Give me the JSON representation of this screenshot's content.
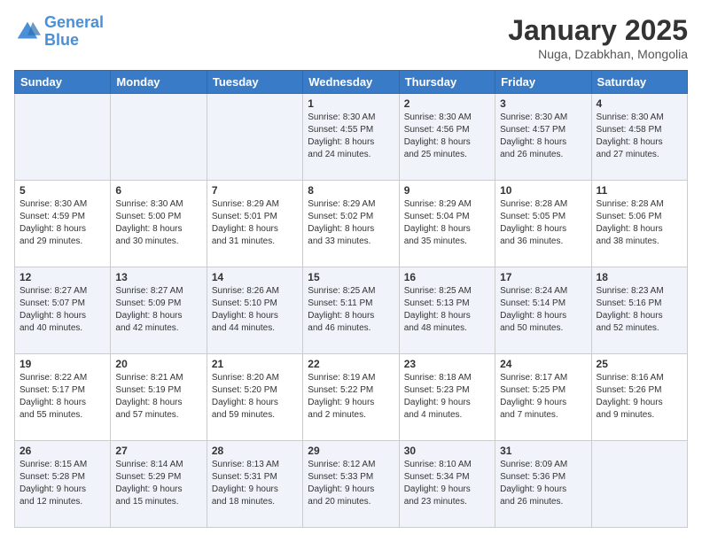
{
  "header": {
    "logo_line1": "General",
    "logo_line2": "Blue",
    "month_title": "January 2025",
    "subtitle": "Nuga, Dzabkhan, Mongolia"
  },
  "weekdays": [
    "Sunday",
    "Monday",
    "Tuesday",
    "Wednesday",
    "Thursday",
    "Friday",
    "Saturday"
  ],
  "weeks": [
    [
      {
        "day": "",
        "info": ""
      },
      {
        "day": "",
        "info": ""
      },
      {
        "day": "",
        "info": ""
      },
      {
        "day": "1",
        "info": "Sunrise: 8:30 AM\nSunset: 4:55 PM\nDaylight: 8 hours\nand 24 minutes."
      },
      {
        "day": "2",
        "info": "Sunrise: 8:30 AM\nSunset: 4:56 PM\nDaylight: 8 hours\nand 25 minutes."
      },
      {
        "day": "3",
        "info": "Sunrise: 8:30 AM\nSunset: 4:57 PM\nDaylight: 8 hours\nand 26 minutes."
      },
      {
        "day": "4",
        "info": "Sunrise: 8:30 AM\nSunset: 4:58 PM\nDaylight: 8 hours\nand 27 minutes."
      }
    ],
    [
      {
        "day": "5",
        "info": "Sunrise: 8:30 AM\nSunset: 4:59 PM\nDaylight: 8 hours\nand 29 minutes."
      },
      {
        "day": "6",
        "info": "Sunrise: 8:30 AM\nSunset: 5:00 PM\nDaylight: 8 hours\nand 30 minutes."
      },
      {
        "day": "7",
        "info": "Sunrise: 8:29 AM\nSunset: 5:01 PM\nDaylight: 8 hours\nand 31 minutes."
      },
      {
        "day": "8",
        "info": "Sunrise: 8:29 AM\nSunset: 5:02 PM\nDaylight: 8 hours\nand 33 minutes."
      },
      {
        "day": "9",
        "info": "Sunrise: 8:29 AM\nSunset: 5:04 PM\nDaylight: 8 hours\nand 35 minutes."
      },
      {
        "day": "10",
        "info": "Sunrise: 8:28 AM\nSunset: 5:05 PM\nDaylight: 8 hours\nand 36 minutes."
      },
      {
        "day": "11",
        "info": "Sunrise: 8:28 AM\nSunset: 5:06 PM\nDaylight: 8 hours\nand 38 minutes."
      }
    ],
    [
      {
        "day": "12",
        "info": "Sunrise: 8:27 AM\nSunset: 5:07 PM\nDaylight: 8 hours\nand 40 minutes."
      },
      {
        "day": "13",
        "info": "Sunrise: 8:27 AM\nSunset: 5:09 PM\nDaylight: 8 hours\nand 42 minutes."
      },
      {
        "day": "14",
        "info": "Sunrise: 8:26 AM\nSunset: 5:10 PM\nDaylight: 8 hours\nand 44 minutes."
      },
      {
        "day": "15",
        "info": "Sunrise: 8:25 AM\nSunset: 5:11 PM\nDaylight: 8 hours\nand 46 minutes."
      },
      {
        "day": "16",
        "info": "Sunrise: 8:25 AM\nSunset: 5:13 PM\nDaylight: 8 hours\nand 48 minutes."
      },
      {
        "day": "17",
        "info": "Sunrise: 8:24 AM\nSunset: 5:14 PM\nDaylight: 8 hours\nand 50 minutes."
      },
      {
        "day": "18",
        "info": "Sunrise: 8:23 AM\nSunset: 5:16 PM\nDaylight: 8 hours\nand 52 minutes."
      }
    ],
    [
      {
        "day": "19",
        "info": "Sunrise: 8:22 AM\nSunset: 5:17 PM\nDaylight: 8 hours\nand 55 minutes."
      },
      {
        "day": "20",
        "info": "Sunrise: 8:21 AM\nSunset: 5:19 PM\nDaylight: 8 hours\nand 57 minutes."
      },
      {
        "day": "21",
        "info": "Sunrise: 8:20 AM\nSunset: 5:20 PM\nDaylight: 8 hours\nand 59 minutes."
      },
      {
        "day": "22",
        "info": "Sunrise: 8:19 AM\nSunset: 5:22 PM\nDaylight: 9 hours\nand 2 minutes."
      },
      {
        "day": "23",
        "info": "Sunrise: 8:18 AM\nSunset: 5:23 PM\nDaylight: 9 hours\nand 4 minutes."
      },
      {
        "day": "24",
        "info": "Sunrise: 8:17 AM\nSunset: 5:25 PM\nDaylight: 9 hours\nand 7 minutes."
      },
      {
        "day": "25",
        "info": "Sunrise: 8:16 AM\nSunset: 5:26 PM\nDaylight: 9 hours\nand 9 minutes."
      }
    ],
    [
      {
        "day": "26",
        "info": "Sunrise: 8:15 AM\nSunset: 5:28 PM\nDaylight: 9 hours\nand 12 minutes."
      },
      {
        "day": "27",
        "info": "Sunrise: 8:14 AM\nSunset: 5:29 PM\nDaylight: 9 hours\nand 15 minutes."
      },
      {
        "day": "28",
        "info": "Sunrise: 8:13 AM\nSunset: 5:31 PM\nDaylight: 9 hours\nand 18 minutes."
      },
      {
        "day": "29",
        "info": "Sunrise: 8:12 AM\nSunset: 5:33 PM\nDaylight: 9 hours\nand 20 minutes."
      },
      {
        "day": "30",
        "info": "Sunrise: 8:10 AM\nSunset: 5:34 PM\nDaylight: 9 hours\nand 23 minutes."
      },
      {
        "day": "31",
        "info": "Sunrise: 8:09 AM\nSunset: 5:36 PM\nDaylight: 9 hours\nand 26 minutes."
      },
      {
        "day": "",
        "info": ""
      }
    ]
  ]
}
